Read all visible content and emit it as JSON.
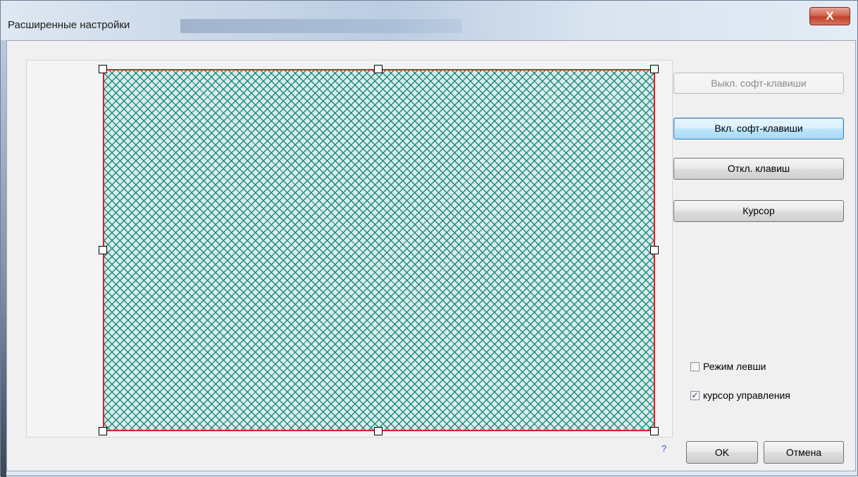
{
  "window": {
    "title": "Расширенные настройки",
    "close_glyph": "X"
  },
  "buttons": {
    "soft_off": "Выкл. софт-клавиши",
    "soft_on": "Вкл. софт-клавиши",
    "keys_off": "Откл. клавиш",
    "cursor": "Курсор",
    "ok": "OK",
    "cancel": "Отмена"
  },
  "checkboxes": [
    {
      "label": "Режим левши",
      "checked": false,
      "check_glyph": ""
    },
    {
      "label": "курсор управления",
      "checked": true,
      "check_glyph": "✓"
    }
  ],
  "help_link": "?",
  "colors": {
    "selection_border": "#e02020",
    "hatch": "#1f8a80",
    "close_button": "#c0402a"
  }
}
